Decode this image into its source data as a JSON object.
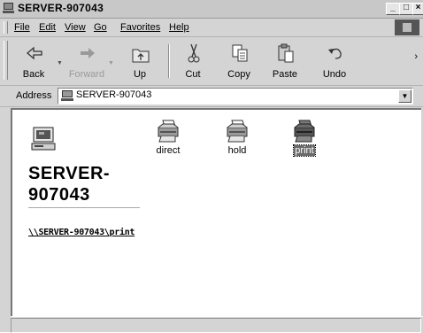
{
  "window": {
    "title": "SERVER-907043"
  },
  "menubar": {
    "items": [
      {
        "label": "File"
      },
      {
        "label": "Edit"
      },
      {
        "label": "View"
      },
      {
        "label": "Go"
      },
      {
        "label": "Favorites"
      },
      {
        "label": "Help"
      }
    ]
  },
  "toolbar": {
    "back": "Back",
    "forward": "Forward",
    "up": "Up",
    "cut": "Cut",
    "copy": "Copy",
    "paste": "Paste",
    "undo": "Undo"
  },
  "address": {
    "label": "Address",
    "value": "SERVER-907043"
  },
  "sidebar": {
    "server_name": "SERVER-907043",
    "selected_path": "\\\\SERVER-907043\\print"
  },
  "printers": [
    {
      "label": "direct"
    },
    {
      "label": "hold"
    },
    {
      "label": "print",
      "selected": true
    }
  ]
}
